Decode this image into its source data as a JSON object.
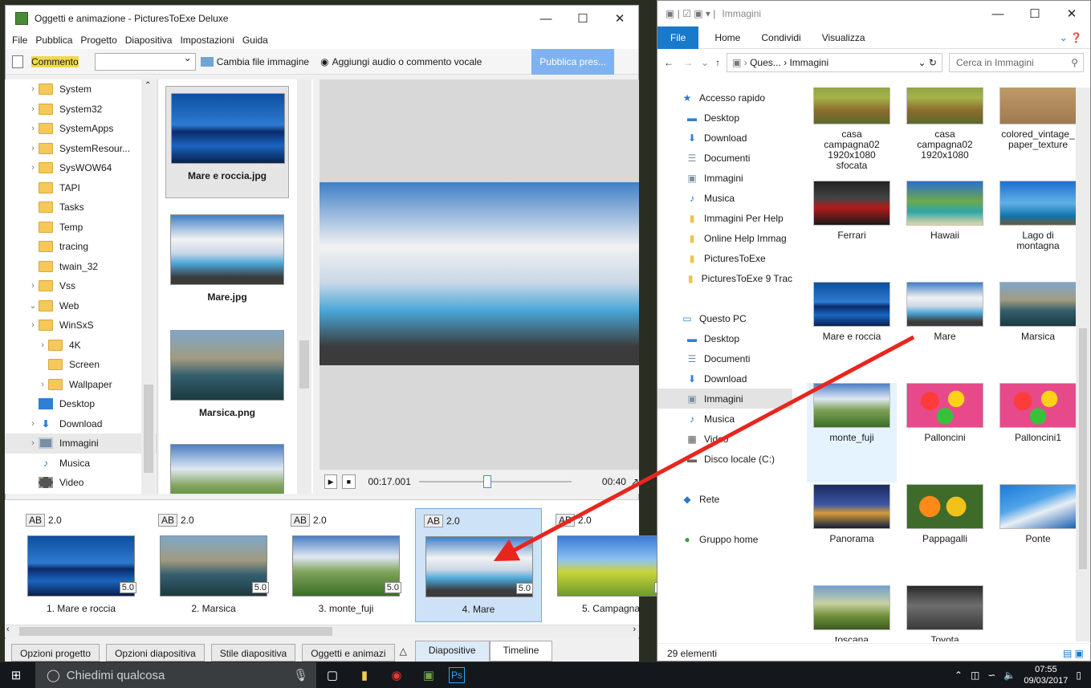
{
  "app": {
    "title": "Oggetti e animazione - PicturesToExe Deluxe",
    "menu": [
      "File",
      "Pubblica",
      "Progetto",
      "Diapositiva",
      "Impostazioni",
      "Guida"
    ],
    "toolbar": {
      "comment": "Commento",
      "change_image": "Cambia file immagine",
      "add_audio": "Aggiungi audio o commento vocale",
      "publish": "Pubblica pres..."
    },
    "tree": [
      {
        "label": "System",
        "chev": ">",
        "icon": "folder"
      },
      {
        "label": "System32",
        "chev": ">",
        "icon": "folder"
      },
      {
        "label": "SystemApps",
        "chev": ">",
        "icon": "folder"
      },
      {
        "label": "SystemResour...",
        "chev": ">",
        "icon": "folder"
      },
      {
        "label": "SysWOW64",
        "chev": ">",
        "icon": "folder"
      },
      {
        "label": "TAPI",
        "chev": "",
        "icon": "folder"
      },
      {
        "label": "Tasks",
        "chev": "",
        "icon": "folder"
      },
      {
        "label": "Temp",
        "chev": "",
        "icon": "folder"
      },
      {
        "label": "tracing",
        "chev": "",
        "icon": "folder"
      },
      {
        "label": "twain_32",
        "chev": "",
        "icon": "folder"
      },
      {
        "label": "Vss",
        "chev": ">",
        "icon": "folder"
      },
      {
        "label": "Web",
        "chev": "v",
        "icon": "folder"
      },
      {
        "label": "WinSxS",
        "chev": ">",
        "icon": "folder"
      },
      {
        "label": "4K",
        "chev": ">",
        "icon": "folder",
        "indent": 1
      },
      {
        "label": "Screen",
        "chev": "",
        "icon": "folder",
        "indent": 1
      },
      {
        "label": "Wallpaper",
        "chev": ">",
        "icon": "folder",
        "indent": 1
      },
      {
        "label": "Desktop",
        "chev": "",
        "icon": "blue"
      },
      {
        "label": "Download",
        "chev": ">",
        "icon": "download"
      },
      {
        "label": "Immagini",
        "chev": ">",
        "icon": "img"
      },
      {
        "label": "Musica",
        "chev": "",
        "icon": "note"
      },
      {
        "label": "Video",
        "chev": "",
        "icon": "video"
      }
    ],
    "thumbnails": [
      "Mare e roccia.jpg",
      "Mare.jpg",
      "Marsica.png",
      ""
    ],
    "player": {
      "time": "00:17.001",
      "end": "00:40",
      "progress": 0.42
    },
    "slides": [
      {
        "ab": "AB",
        "trans": "2.0",
        "duration": "5.0",
        "caption": "1. Mare e roccia"
      },
      {
        "ab": "AB",
        "trans": "2.0",
        "duration": "5.0",
        "caption": "2. Marsica"
      },
      {
        "ab": "AB",
        "trans": "2.0",
        "duration": "5.0",
        "caption": "3. monte_fuji"
      },
      {
        "ab": "AB",
        "trans": "2.0",
        "duration": "5.0",
        "caption": "4. Mare"
      },
      {
        "ab": "AB",
        "trans": "2.0",
        "duration": "5.",
        "caption": "5. Campagna"
      }
    ],
    "bottom_buttons": [
      "Opzioni progetto",
      "Opzioni diapositiva",
      "Stile diapositiva",
      "Oggetti e animazi"
    ],
    "view_tabs": [
      "Diapositive",
      "Timeline"
    ]
  },
  "explorer": {
    "title": "Immagini",
    "ribbon": [
      "File",
      "Home",
      "Condividi",
      "Visualizza"
    ],
    "path": [
      "Ques...",
      "Immagini"
    ],
    "search_placeholder": "Cerca in Immagini",
    "nav": [
      {
        "label": "Accesso rapido",
        "icon": "star",
        "indent": 0
      },
      {
        "label": "Desktop",
        "icon": "blue",
        "indent": 1
      },
      {
        "label": "Download",
        "icon": "download",
        "indent": 1
      },
      {
        "label": "Documenti",
        "icon": "doc",
        "indent": 1
      },
      {
        "label": "Immagini",
        "icon": "img",
        "indent": 1
      },
      {
        "label": "Musica",
        "icon": "note",
        "indent": 1
      },
      {
        "label": "Immagini Per Help",
        "icon": "folder",
        "indent": 1
      },
      {
        "label": "Online Help Immag",
        "icon": "folder",
        "indent": 1
      },
      {
        "label": "PicturesToExe",
        "icon": "folder",
        "indent": 1
      },
      {
        "label": "PicturesToExe 9 Trac",
        "icon": "folder",
        "indent": 1
      },
      {
        "label": "",
        "icon": "",
        "indent": 0
      },
      {
        "label": "Questo PC",
        "icon": "pc",
        "indent": 0
      },
      {
        "label": "Desktop",
        "icon": "blue",
        "indent": 1
      },
      {
        "label": "Documenti",
        "icon": "doc",
        "indent": 1
      },
      {
        "label": "Download",
        "icon": "download",
        "indent": 1
      },
      {
        "label": "Immagini",
        "icon": "img",
        "indent": 1
      },
      {
        "label": "Musica",
        "icon": "note",
        "indent": 1
      },
      {
        "label": "Video",
        "icon": "video",
        "indent": 1
      },
      {
        "label": "Disco locale (C:)",
        "icon": "disk",
        "indent": 1
      },
      {
        "label": "",
        "icon": "",
        "indent": 0
      },
      {
        "label": "Rete",
        "icon": "net",
        "indent": 0
      },
      {
        "label": "",
        "icon": "",
        "indent": 0
      },
      {
        "label": "Gruppo home",
        "icon": "home",
        "indent": 0
      }
    ],
    "files": [
      {
        "name": "casa\ncampagna02\n1920x1080\nsfocata",
        "img": "g-brown"
      },
      {
        "name": "casa\ncampagna02\n1920x1080",
        "img": "g-brown"
      },
      {
        "name": "colored_vintage_\npaper_texture",
        "img": "g-paper"
      },
      {
        "name": "Ferrari",
        "img": "g-ferrari"
      },
      {
        "name": "Hawaii",
        "img": "g-hawaii"
      },
      {
        "name": "Lago di\nmontagna",
        "img": "g-lago"
      },
      {
        "name": "Mare e roccia",
        "img": "g-sea"
      },
      {
        "name": "Mare",
        "img": "g-mare"
      },
      {
        "name": "Marsica",
        "img": "g-marsica"
      },
      {
        "name": "monte_fuji",
        "img": "g-fuji"
      },
      {
        "name": "Palloncini",
        "img": "g-pallon"
      },
      {
        "name": "Palloncini1",
        "img": "g-pallon"
      },
      {
        "name": "Panorama",
        "img": "g-pan"
      },
      {
        "name": "Pappagalli",
        "img": "g-papp"
      },
      {
        "name": "Ponte",
        "img": "g-ponte"
      },
      {
        "name": "toscana",
        "img": "g-tosc"
      },
      {
        "name": "Toyota",
        "img": "g-toyota"
      }
    ],
    "status": "29 elementi"
  },
  "taskbar": {
    "search": "Chiedimi qualcosa",
    "time": "07:55",
    "date": "09/03/2017"
  },
  "colors": {
    "accent": "#1979ca",
    "arrow": "#e8261e",
    "selection": "#cde2f6"
  }
}
